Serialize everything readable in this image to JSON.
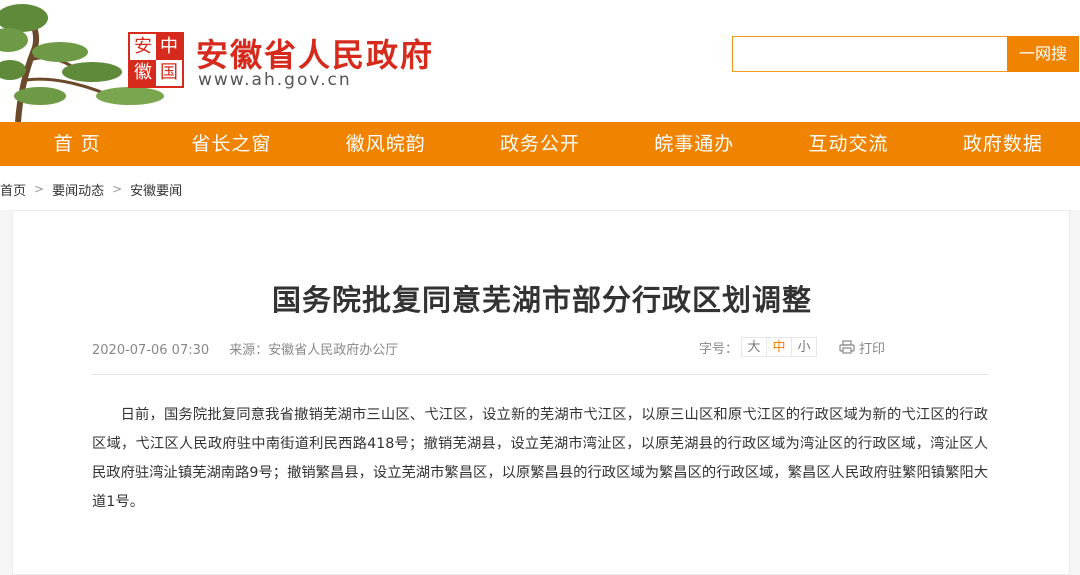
{
  "header": {
    "seal_chars": [
      "安",
      "中",
      "徽",
      "国"
    ],
    "site_title": "安徽省人民政府",
    "site_url": "www.ah.gov.cn",
    "search": {
      "value": "",
      "placeholder": "",
      "button_label": "一网搜"
    }
  },
  "nav": {
    "items": [
      "首 页",
      "省长之窗",
      "徽风皖韵",
      "政务公开",
      "皖事通办",
      "互动交流",
      "政府数据"
    ]
  },
  "breadcrumb": {
    "items": [
      "首页",
      "要闻动态",
      "安徽要闻"
    ],
    "separator": ">"
  },
  "article": {
    "title": "国务院批复同意芜湖市部分行政区划调整",
    "date": "2020-07-06 07:30",
    "source": "来源：安徽省人民政府办公厅",
    "fontsize_label": "字号：",
    "fontsize_options": [
      "大",
      "中",
      "小"
    ],
    "fontsize_selected": "中",
    "print_label": "打印",
    "body": "日前，国务院批复同意我省撤销芜湖市三山区、弋江区，设立新的芜湖市弋江区，以原三山区和原弋江区的行政区域为新的弋江区的行政区域，弋江区人民政府驻中南街道利民西路418号；撤销芜湖县，设立芜湖市湾沚区，以原芜湖县的行政区域为湾沚区的行政区域，湾沚区人民政府驻湾沚镇芜湖南路9号；撤销繁昌县，设立芜湖市繁昌区，以原繁昌县的行政区域为繁昌区的行政区域，繁昌区人民政府驻繁阳镇繁阳大道1号。"
  },
  "colors": {
    "brand_red": "#d62b1c",
    "accent_orange": "#f08300"
  }
}
